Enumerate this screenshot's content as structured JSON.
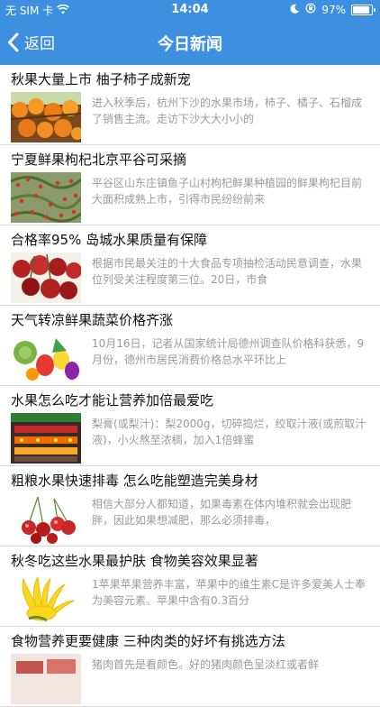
{
  "status_bar": {
    "carrier": "无 SIM 卡",
    "time": "14:04",
    "battery": "97%",
    "battery_level": 0.97,
    "icons": [
      "wifi-icon",
      "moon-icon",
      "rotation-lock-icon",
      "battery-icon"
    ]
  },
  "nav": {
    "back_label": "返回",
    "title": "今日新闻",
    "back_icon": "chevron-left-icon"
  },
  "colors": {
    "accent": "#3d8fe0",
    "title_text": "#111111",
    "summary_text": "#9a9a9a",
    "divider": "#d9d9d9"
  },
  "articles": [
    {
      "title": "秋果大量上市 柚子柿子成新宠",
      "summary": "进入秋季后，杭州下沙的水果市场，柿子、橘子、石榴成了销售主流。走访下沙大大小小的",
      "image": "persimmons-image"
    },
    {
      "title": "宁夏鲜果枸杞北京平谷可采摘",
      "summary": "平谷区山东庄镇鱼子山村枸杞鲜果种植园的鲜果枸杞目前大面积成熟上市，引得市民纷纷前来",
      "image": "goji-berries-image"
    },
    {
      "title": "合格率95% 岛城水果质量有保障",
      "summary": "根据市民最关注的十大食品专项抽检活动民意调查，水果位列受关注程度第三位。20日，市食",
      "image": "cherries-image"
    },
    {
      "title": "天气转凉鲜果蔬菜价格齐涨",
      "summary": "10月16日，记者从国家统计局德州调查队价格科获悉，9月份，德州市居民消费价格总水平环比上",
      "image": "vegetables-image"
    },
    {
      "title": "水果怎么吃才能让营养加倍最爱吃",
      "summary": "梨膏(或梨汁)：梨2000g，切碎捣烂，绞取汁液(或煎取汁液)，小火熬至浓稠，加入1倍蜂蜜",
      "image": "fruit-shop-image"
    },
    {
      "title": "粗粮水果快速排毒 怎么吃能塑造完美身材",
      "summary": "相信大部分人都知道，如果毒素在体内堆积就会出现肥胖，因此如果想减肥，那么必须排毒，",
      "image": "red-cherries-image"
    },
    {
      "title": "秋冬吃这些水果最护肤 食物美容效果显著",
      "summary": "1苹果苹果营养丰富，苹果中的维生素C是许多爱美人士奉为美容元素。苹果中含有0.3百分",
      "image": "buddhas-hand-image"
    },
    {
      "title": "食物营养更要健康 三种肉类的好坏有挑选方法",
      "summary": "猪肉首先是看颜色。好的猪肉颜色呈淡红或者鲜",
      "image": "meat-image"
    }
  ]
}
